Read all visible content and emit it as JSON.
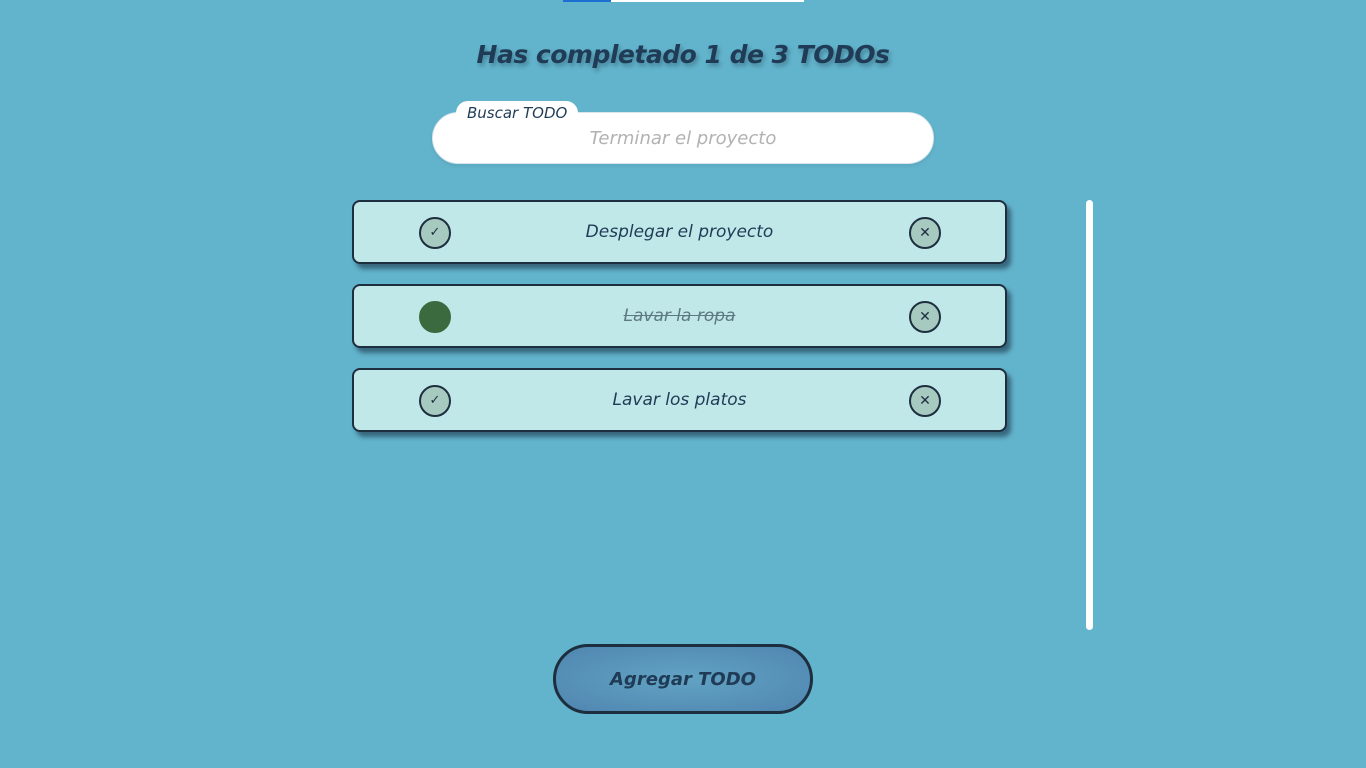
{
  "progress": {
    "completed": 1,
    "total": 3,
    "fraction": 0.2
  },
  "header": {
    "title": "Has completado 1 de 3 TODOs"
  },
  "search": {
    "label": "Buscar TODO",
    "placeholder": "Terminar el proyecto",
    "value": ""
  },
  "todos": [
    {
      "text": "Desplegar el proyecto",
      "completed": false,
      "check_icon": "✓",
      "delete_icon": "✕"
    },
    {
      "text": "Lavar la ropa",
      "completed": true,
      "check_icon": "✓",
      "delete_icon": "✕"
    },
    {
      "text": "Lavar los platos",
      "completed": false,
      "check_icon": "✓",
      "delete_icon": "✕"
    }
  ],
  "actions": {
    "add_label": "Agregar TODO"
  },
  "colors": {
    "background": "#62b4cc",
    "item_background": "#c1e8e8",
    "text": "#1f3b55",
    "completed_check": "#3a6a3e",
    "progress_fill": "#1a6fd0"
  }
}
